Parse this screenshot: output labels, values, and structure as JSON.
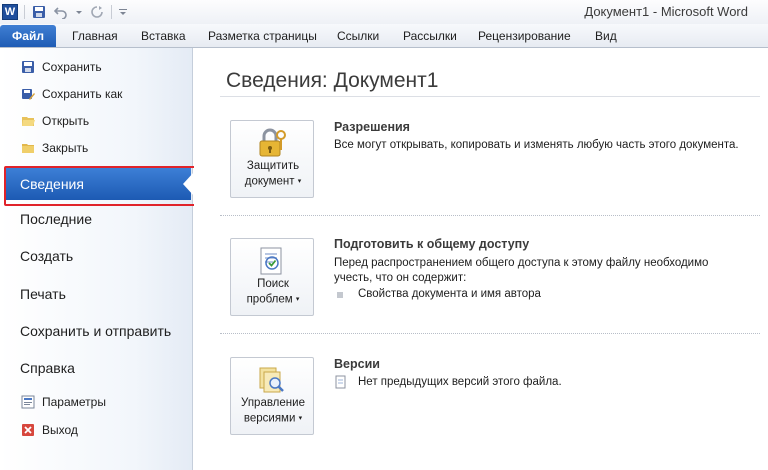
{
  "window": {
    "title": "Документ1 - Microsoft Word",
    "app_logo_letter": "W"
  },
  "ribbon": {
    "file_tab": "Файл",
    "tabs": [
      "Главная",
      "Вставка",
      "Разметка страницы",
      "Ссылки",
      "Рассылки",
      "Рецензирование",
      "Вид"
    ]
  },
  "backstage": {
    "commands": [
      {
        "label": "Сохранить",
        "icon": "save-icon"
      },
      {
        "label": "Сохранить как",
        "icon": "save-as-icon"
      },
      {
        "label": "Открыть",
        "icon": "open-folder-icon"
      },
      {
        "label": "Закрыть",
        "icon": "close-folder-icon"
      }
    ],
    "selected": "Сведения",
    "sections": [
      "Последние",
      "Создать",
      "Печать",
      "Сохранить и отправить",
      "Справка"
    ],
    "options_label": "Параметры",
    "exit_label": "Выход"
  },
  "info": {
    "heading": "Сведения: Документ1",
    "protect": {
      "button_line1": "Защитить",
      "button_line2": "документ",
      "title": "Разрешения",
      "text": "Все могут открывать, копировать и изменять любую часть этого документа."
    },
    "inspect": {
      "button_line1": "Поиск",
      "button_line2": "проблем",
      "title": "Подготовить к общему доступу",
      "text_line1": "Перед распространением общего доступа к этому файлу необходимо",
      "text_line2": "учесть, что он содержит:",
      "bullet": "Свойства документа и имя автора"
    },
    "versions": {
      "button_line1": "Управление",
      "button_line2": "версиями",
      "title": "Версии",
      "text": "Нет предыдущих версий этого файла."
    }
  },
  "colors": {
    "accent": "#1f5cb5",
    "highlight_box": "#e0232a"
  }
}
